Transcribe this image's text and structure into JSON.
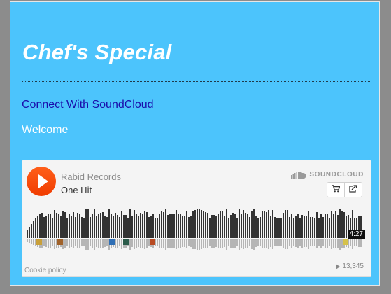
{
  "page": {
    "title": "Chef's Special",
    "connect_link": "Connect With SoundCloud",
    "welcome": "Welcome"
  },
  "player": {
    "artist": "Rabid Records",
    "track": "One Hit",
    "brand": "SOUNDCLOUD",
    "duration": "4:27",
    "cookie_policy": "Cookie policy",
    "play_count": "13,345",
    "colors": {
      "accent": "#f5500a",
      "waveform": "#333333",
      "waveform_reflection": "#b5b5b5"
    }
  },
  "icons": {
    "play": "play-icon",
    "brand": "soundcloud-logo-icon",
    "buy": "cart-icon",
    "share": "share-icon",
    "plays": "play-count-icon"
  },
  "comment_avatars": [
    {
      "color": "#c9a03a"
    },
    {
      "color": "#a0622a"
    },
    {
      "color": "#2f6fb5"
    },
    {
      "color": "#2b5b4a"
    },
    {
      "color": "#b84a22"
    },
    {
      "color": "#d6c24a"
    }
  ]
}
